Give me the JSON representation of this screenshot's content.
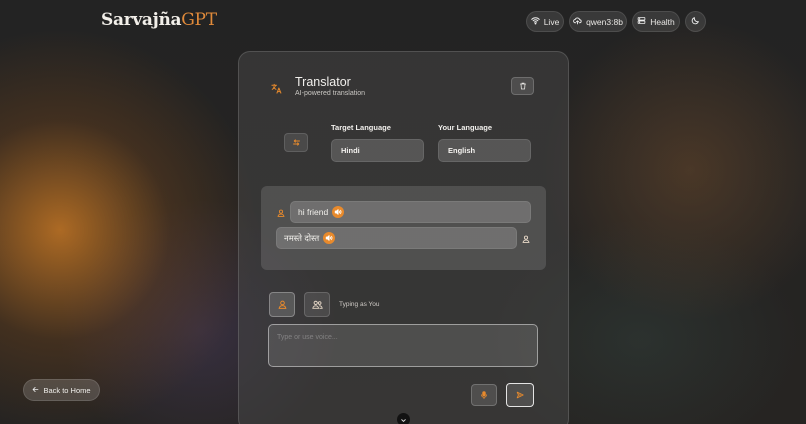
{
  "brand": {
    "name_main": "Sarvajña",
    "name_accent": "GPT"
  },
  "header": {
    "status_label": "Live",
    "model_label": "qwen3:8b",
    "health_label": "Health",
    "status_icon": "wifi-icon",
    "model_icon": "cloud-upload-icon",
    "health_icon": "server-icon",
    "theme_icon": "moon-icon"
  },
  "translator": {
    "title": "Translator",
    "subtitle": "AI-powered translation",
    "target_language_label": "Target Language",
    "target_language_value": "Hindi",
    "your_language_label": "Your Language",
    "your_language_value": "English"
  },
  "messages": [
    {
      "text": "hi friend",
      "side": "left"
    },
    {
      "text": "नमस्ते दोस्त",
      "side": "right"
    }
  ],
  "composer": {
    "typing_as": "Typing as You",
    "placeholder": "Type or use voice..."
  },
  "nav": {
    "back_label": "Back to Home"
  },
  "colors": {
    "accent": "#e88a2c",
    "brand_accent": "#e08a3a"
  }
}
